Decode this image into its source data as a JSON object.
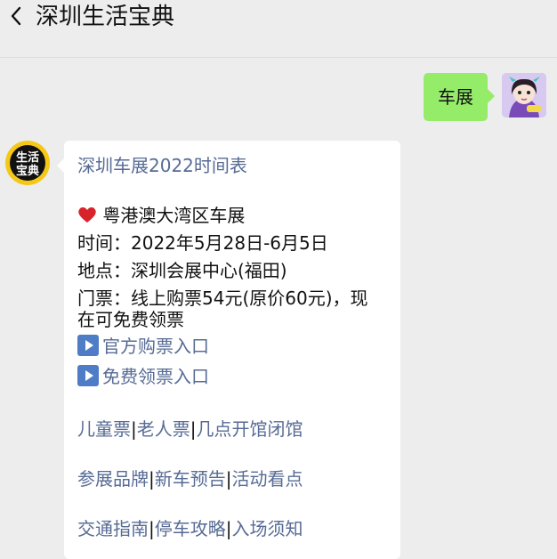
{
  "header": {
    "title": "深圳生活宝典"
  },
  "chat": {
    "outgoing_message": "车展",
    "reply": {
      "heading_link": "深圳车展2022时间表",
      "event_name": "粤港澳大湾区车展",
      "time_line": "时间：2022年5月28日-6月5日",
      "place_line": "地点：深圳会展中心(福田)",
      "ticket_line_1": "门票：线上购票54元(原价60元)，现",
      "ticket_line_2": "在可免费领票",
      "official_ticket_link": "官方购票入口",
      "free_ticket_link": "免费领票入口",
      "links_row_1": [
        "儿童票",
        "老人票",
        "几点开馆闭馆"
      ],
      "links_row_2": [
        "参展品牌",
        "新车预告",
        "活动看点"
      ],
      "links_row_3": [
        "交通指南",
        "停车攻略",
        "入场须知"
      ]
    },
    "bot_avatar_text": [
      "生活",
      "宝典"
    ],
    "separator": "|"
  },
  "colors": {
    "link": "#576b95",
    "outgoing_bubble": "#95ec69",
    "background": "#ededed",
    "heart": "#d8232a"
  }
}
